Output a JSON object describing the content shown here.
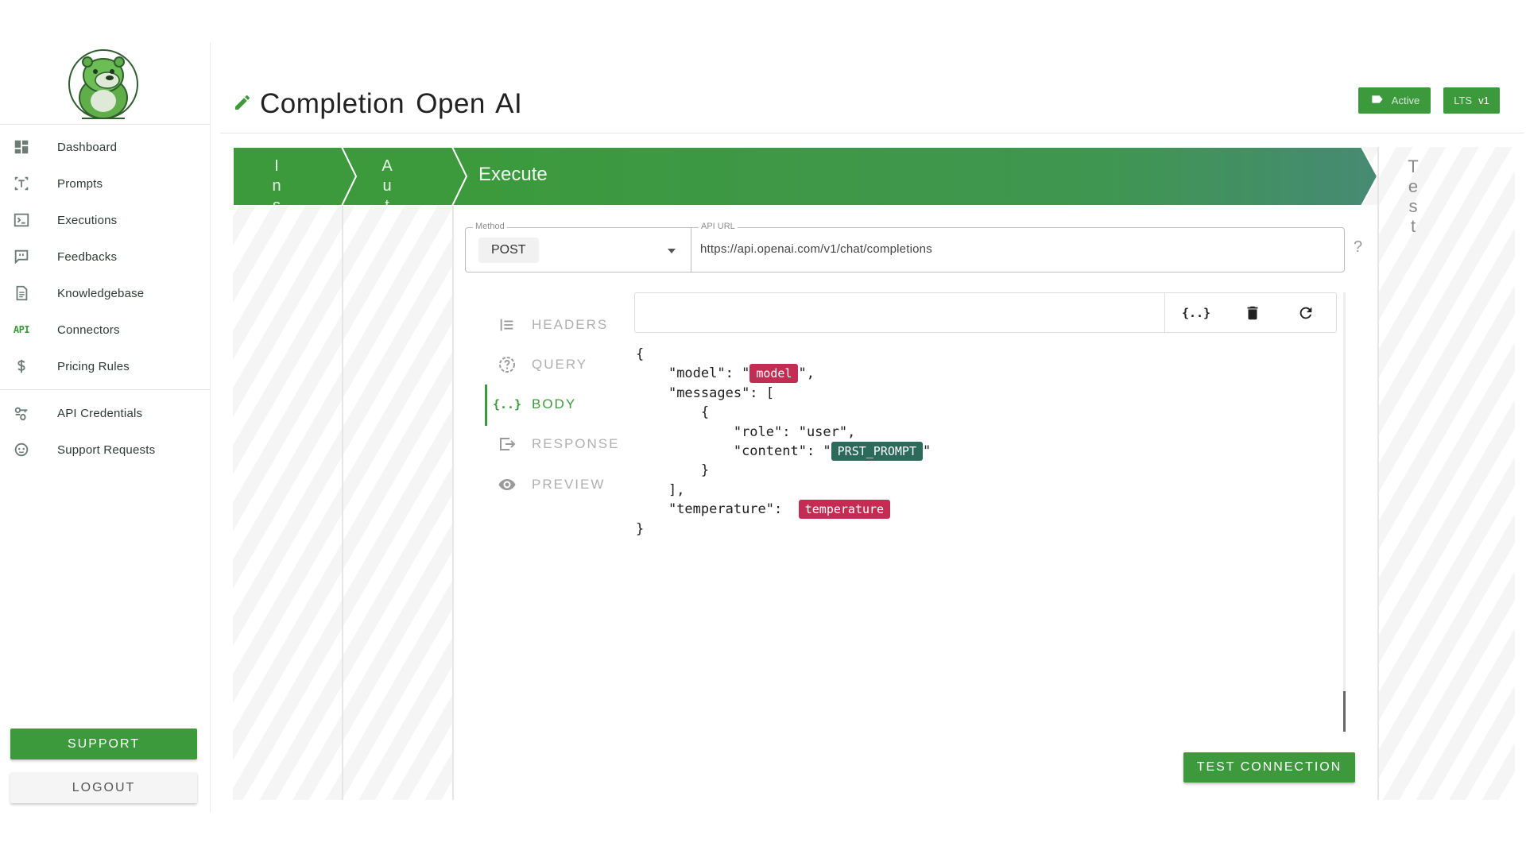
{
  "sidebar": {
    "items": [
      {
        "label": "Dashboard",
        "icon": "dashboard-icon"
      },
      {
        "label": "Prompts",
        "icon": "prompt-icon"
      },
      {
        "label": "Executions",
        "icon": "terminal-icon"
      },
      {
        "label": "Feedbacks",
        "icon": "feedback-icon"
      },
      {
        "label": "Knowledgebase",
        "icon": "document-icon"
      },
      {
        "label": "Connectors",
        "icon": "api-icon",
        "icon_text": "API"
      },
      {
        "label": "Pricing Rules",
        "icon": "dollar-icon"
      },
      {
        "label": "API Credentials",
        "icon": "key-icon"
      },
      {
        "label": "Support Requests",
        "icon": "support-icon"
      }
    ],
    "support_label": "SUPPORT",
    "logout_label": "LOGOUT"
  },
  "header": {
    "title": "Completion Open AI",
    "status_badge": "Active",
    "version_badge": {
      "prefix": "LTS",
      "version": "v1"
    }
  },
  "stages": {
    "first_letters": [
      "I",
      "n",
      "s"
    ],
    "second_letters": [
      "A",
      "u",
      "t"
    ],
    "current": "Execute",
    "last_letters": [
      "T",
      "e",
      "s",
      "t"
    ]
  },
  "form": {
    "method_legend": "Method",
    "method_value": "POST",
    "url_legend": "API URL",
    "url_value": "https://api.openai.com/v1/chat/completions",
    "help": "?"
  },
  "tabs": [
    {
      "label": "HEADERS"
    },
    {
      "label": "QUERY"
    },
    {
      "label": "BODY",
      "active": true
    },
    {
      "label": "RESPONSE"
    },
    {
      "label": "PREVIEW"
    }
  ],
  "editor": {
    "format_button": "{..}",
    "code": {
      "open": "{",
      "model_key": "\"model\": \"",
      "model_tag": "model",
      "model_end": "\",",
      "messages_key": "\"messages\": [",
      "obj_open": "{",
      "role_line": "\"role\": \"user\",",
      "content_key": "\"content\": \"",
      "content_tag": "PRST_PROMPT",
      "content_end": "\"",
      "obj_close": "}",
      "arr_close": "],",
      "temp_key": "\"temperature\": ",
      "temp_tag": "temperature",
      "close": "}"
    }
  },
  "test_button": "TEST CONNECTION",
  "colors": {
    "accent": "#3c9a3c",
    "tag_red": "#c42d53",
    "tag_teal": "#2c6a5c"
  }
}
